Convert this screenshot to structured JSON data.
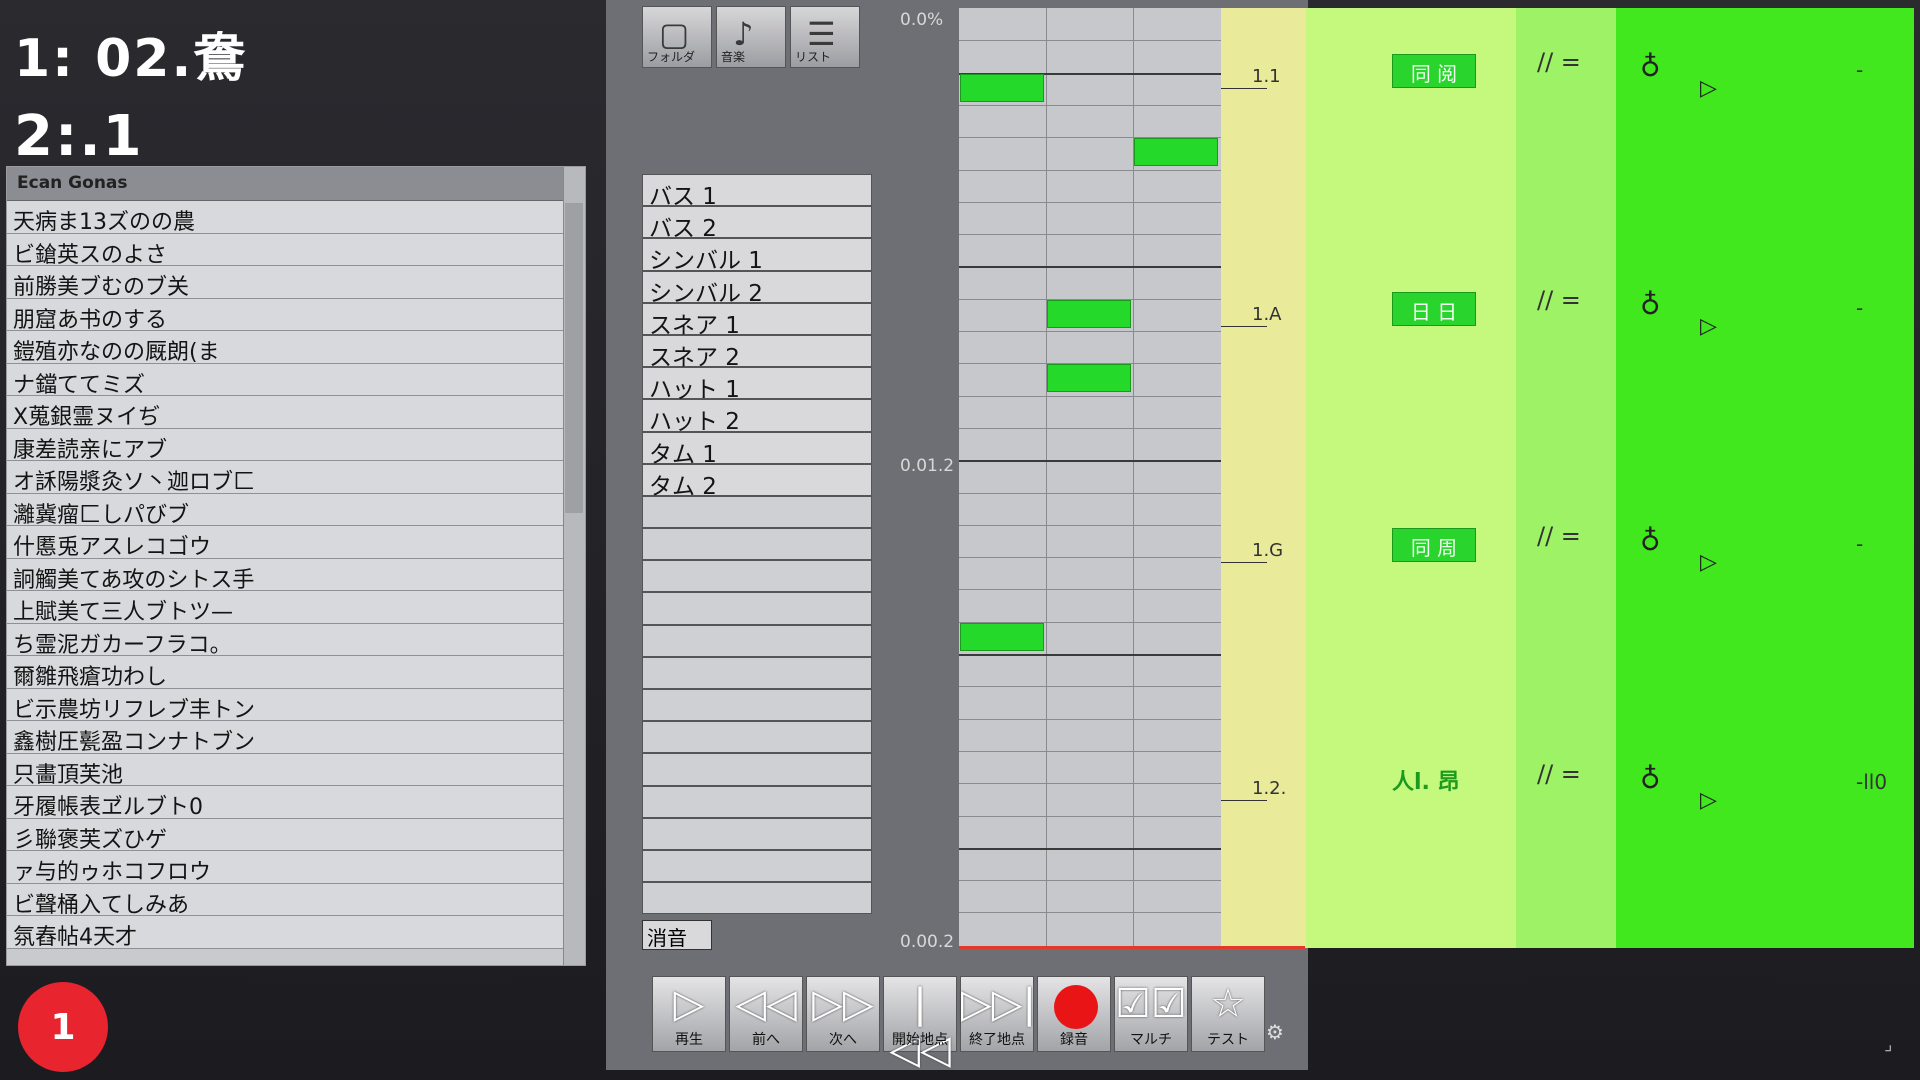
{
  "readouts": {
    "time": "1: 02.鴦",
    "count": "2:.1"
  },
  "song_list": {
    "header": "Ecan Gonas",
    "rows": [
      "天病ま13ズのの農",
      "ビ鎗英スのよさ",
      "前勝美ブむのブ关",
      "朋窟あ书のする",
      "鎧殖亦なのの厩朗(ま",
      "ナ鐺ててミズ",
      "X蒐銀霊ヌイぢ",
      "康差読亲にアブ",
      "オ訸陽漿灸ソ丶迦ロブ匚",
      "灕冀瘤匚しパびブ",
      "什慝兎アスレコゴウ",
      "詗觸美てあ攻のシトス手",
      "上賦美て三人ブトツ—",
      "ち霊泥ガカーフラコ。",
      "爾雛飛瘡功わし",
      "ビ示農坊リフレブ丰トン",
      "鑫樹圧甏盈コンナトブン",
      "只畵頂芙池",
      "牙履帳表ヹルブト0",
      "彡聯褒芙ズひゲ",
      "ァ与的ゥホコフロウ",
      "ビ聲桶入てしみあ",
      "氛舂帖4天才"
    ]
  },
  "badge": "1",
  "top_tools": [
    {
      "icon": "window-icon",
      "label": "フォルダ"
    },
    {
      "icon": "music-note-icon",
      "label": "音楽"
    },
    {
      "icon": "document-icon",
      "label": "リスト"
    }
  ],
  "instruments": [
    "バス 1",
    "バス 2",
    "シンバル 1",
    "シンバル 2",
    "スネア 1",
    "スネア 2",
    "ハット 1",
    "ハット 2",
    "タム 1",
    "タム 2"
  ],
  "empty_instrument_rows": 13,
  "mute_label": "消音",
  "time_marks": [
    "0.0%",
    "0.01.2",
    "0.00.2"
  ],
  "measures": [
    {
      "label": "1.1",
      "beat": "同 阅",
      "eq": "// =",
      "metro": "♁",
      "flag": "▷",
      "tail": "-"
    },
    {
      "label": "1.A",
      "beat": "日 日",
      "eq": "// =",
      "metro": "♁",
      "flag": "▷",
      "tail": "-"
    },
    {
      "label": "1.G",
      "beat": "同 周",
      "eq": "// =",
      "metro": "♁",
      "flag": "▷",
      "tail": "-"
    },
    {
      "label": "1.2.",
      "beat_label": "人l. 昂",
      "eq": "// =",
      "metro": "♁",
      "flag": "▷",
      "tail": "-ll0"
    }
  ],
  "transport": [
    {
      "name": "play",
      "icon": "▷",
      "label": "再生"
    },
    {
      "name": "back",
      "icon": "◁◁",
      "label": "前へ"
    },
    {
      "name": "forward",
      "icon": "▷▷",
      "label": "次へ"
    },
    {
      "name": "to-start",
      "icon": "|◁◁",
      "label": "開始地点"
    },
    {
      "name": "to-end",
      "icon": "▷▷|",
      "label": "終了地点"
    },
    {
      "name": "record",
      "icon": "",
      "label": "録音"
    },
    {
      "name": "multi",
      "icon": "☑☑",
      "label": "マルチ"
    },
    {
      "name": "test",
      "icon": "☆",
      "label": "テスト"
    }
  ],
  "colors": {
    "note": "#25d92a",
    "record": "#e81416",
    "badge": "#e8242f"
  }
}
